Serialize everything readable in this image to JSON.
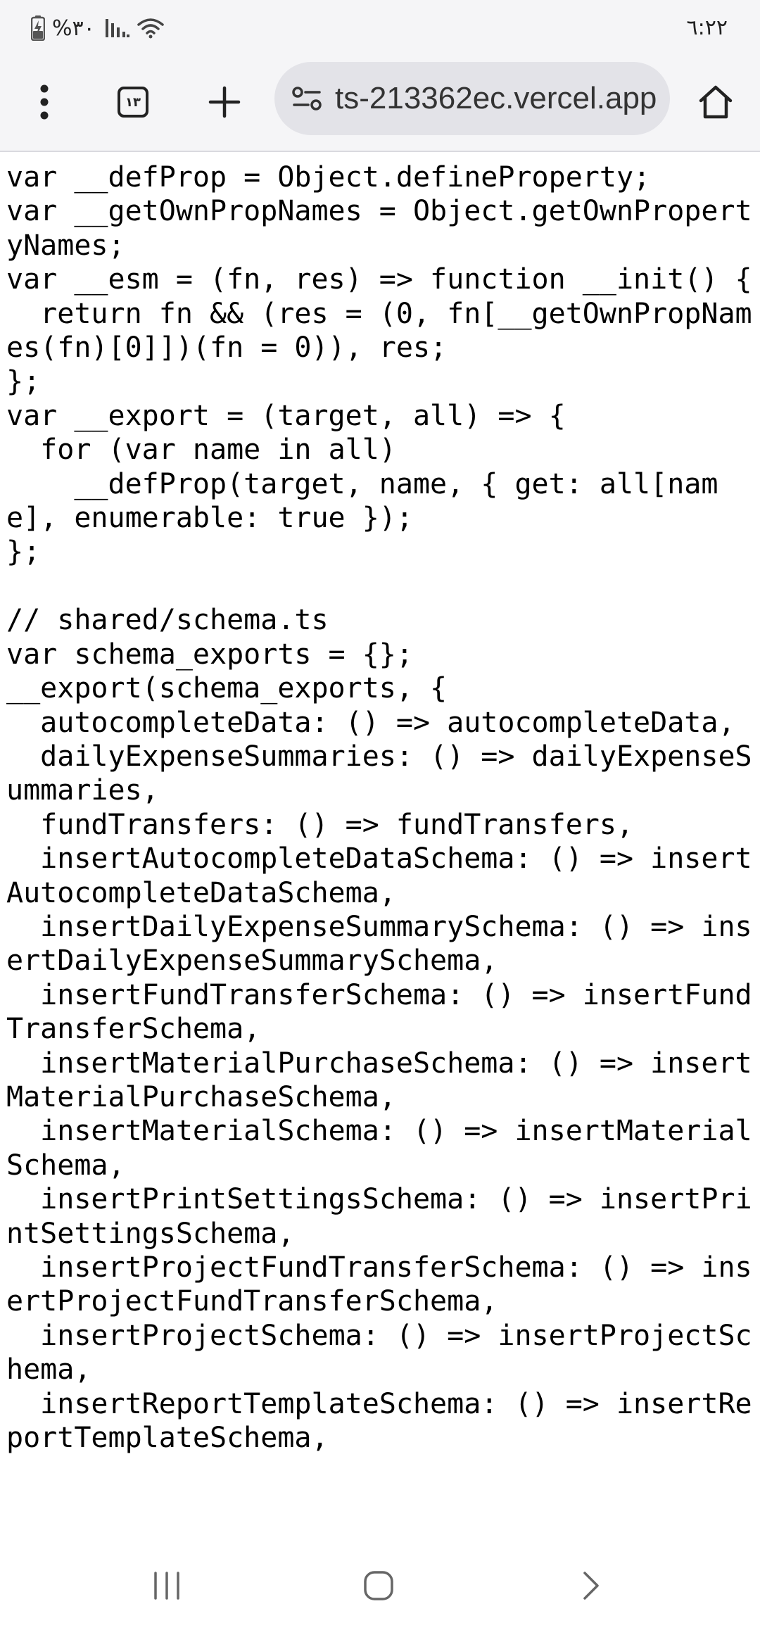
{
  "status_bar": {
    "battery_percent": "%٣٠",
    "time": "٦:٢٢"
  },
  "toolbar": {
    "tab_count": "١٣",
    "url": "ts-213362ec.vercel.app"
  },
  "page": {
    "code": "var __defProp = Object.defineProperty;\nvar __getOwnPropNames = Object.getOwnPropertyNames;\nvar __esm = (fn, res) => function __init() {\n  return fn && (res = (0, fn[__getOwnPropNames(fn)[0]])(fn = 0)), res;\n};\nvar __export = (target, all) => {\n  for (var name in all)\n    __defProp(target, name, { get: all[name], enumerable: true });\n};\n\n// shared/schema.ts\nvar schema_exports = {};\n__export(schema_exports, {\n  autocompleteData: () => autocompleteData,\n  dailyExpenseSummaries: () => dailyExpenseSummaries,\n  fundTransfers: () => fundTransfers,\n  insertAutocompleteDataSchema: () => insertAutocompleteDataSchema,\n  insertDailyExpenseSummarySchema: () => insertDailyExpenseSummarySchema,\n  insertFundTransferSchema: () => insertFundTransferSchema,\n  insertMaterialPurchaseSchema: () => insertMaterialPurchaseSchema,\n  insertMaterialSchema: () => insertMaterialSchema,\n  insertPrintSettingsSchema: () => insertPrintSettingsSchema,\n  insertProjectFundTransferSchema: () => insertProjectFundTransferSchema,\n  insertProjectSchema: () => insertProjectSchema,\n  insertReportTemplateSchema: () => insertReportTemplateSchema,"
  }
}
